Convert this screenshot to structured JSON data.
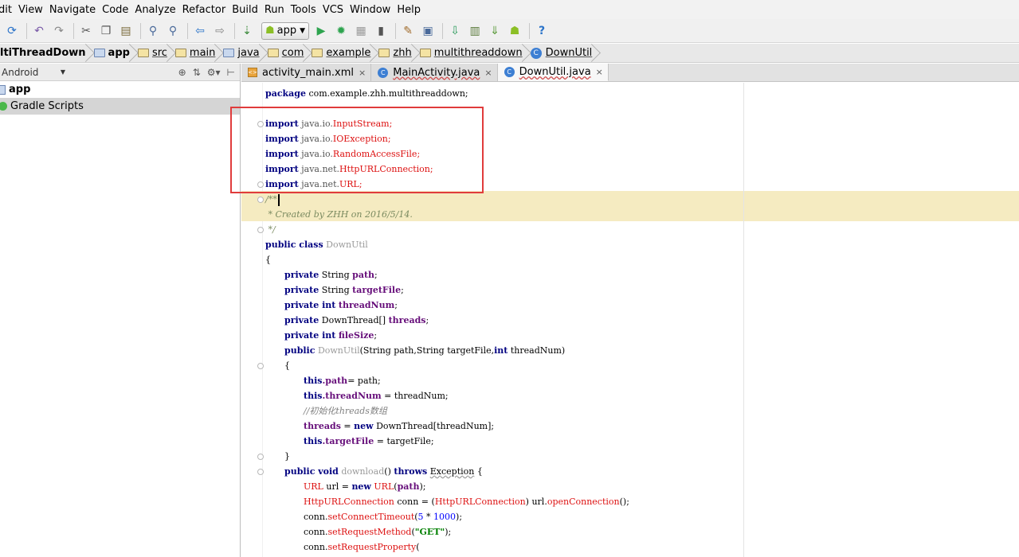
{
  "menu": [
    "dit",
    "View",
    "Navigate",
    "Code",
    "Analyze",
    "Refactor",
    "Build",
    "Run",
    "Tools",
    "VCS",
    "Window",
    "Help"
  ],
  "toolbar": {
    "run_config": "app"
  },
  "breadcrumb": [
    "ltiThreadDown",
    "app",
    "src",
    "main",
    "java",
    "com",
    "example",
    "zhh",
    "multithreaddown",
    "DownUtil"
  ],
  "project_panel": {
    "view_mode": "Android",
    "items": [
      {
        "label": "app"
      },
      {
        "label": "Gradle Scripts"
      }
    ]
  },
  "tabs": [
    {
      "label": "activity_main.xml",
      "close": "×"
    },
    {
      "label": "MainActivity.java",
      "close": "×"
    },
    {
      "label": "DownUtil.java",
      "close": "×"
    }
  ],
  "code": {
    "package_kw": "package",
    "package_name": "com.example.zhh.multithreaddown;",
    "imports": [
      {
        "kw": "import",
        "pkg": "java.io.",
        "cls": "InputStream",
        "end": ";"
      },
      {
        "kw": "import",
        "pkg": "java.io.",
        "cls": "IOException",
        "end": ";"
      },
      {
        "kw": "import",
        "pkg": "java.io.",
        "cls": "RandomAccessFile",
        "end": ";"
      },
      {
        "kw": "import",
        "pkg": "java.net.",
        "cls": "HttpURLConnection",
        "end": ";"
      },
      {
        "kw": "import",
        "pkg": "java.net.",
        "cls": "URL",
        "end": ";"
      }
    ],
    "doc_open": "/**",
    "doc_body": " * Created by ZHH on 2016/5/14.",
    "doc_close": " */",
    "class_decl": {
      "mods": "public class",
      "name": "DownUtil"
    },
    "open_brace": "{",
    "fields": [
      {
        "mods": "private",
        "type": "String",
        "name": "path",
        "end": ";"
      },
      {
        "mods": "private",
        "type": "String",
        "name": "targetFile",
        "end": ";"
      },
      {
        "mods": "private int",
        "type": "",
        "name": "threadNum",
        "end": ";"
      },
      {
        "mods": "private",
        "type": "DownThread[]",
        "name": "threads",
        "end": ";"
      },
      {
        "mods": "private int",
        "type": "",
        "name": "fileSize",
        "end": ";"
      }
    ],
    "ctor": {
      "mods": "public",
      "name": "DownUtil",
      "params": "(String path,String targetFile,",
      "int_kw": "int",
      "param_end": " threadNum)"
    },
    "ctor_open": "{",
    "ctor_body": [
      {
        "this": "this",
        "field": ".path",
        "rest": "= path;"
      },
      {
        "this": "this",
        "field": ".threadNum",
        "rest": " = threadNum;"
      }
    ],
    "ctor_comment": "//初始化threads数组",
    "ctor_threads": {
      "field": "threads",
      "eq": " = ",
      "new_kw": "new",
      "rest": " DownThread[threadNum];"
    },
    "ctor_target": {
      "this": "this",
      "field": ".targetFile",
      "rest": " = targetFile;"
    },
    "ctor_close": "}",
    "download": {
      "mods": "public void",
      "name": "download",
      "mid": "() ",
      "throws_kw": "throws",
      "exc": "Exception",
      "end": " {"
    },
    "download_body": {
      "l1": {
        "cls": "URL",
        "a": " url = ",
        "new_kw": "new",
        "b": " ",
        "cls2": "URL",
        "c": "(",
        "field": "path",
        "d": ");"
      },
      "l2": {
        "cls": "HttpURLConnection",
        "a": " conn = (",
        "cls2": "HttpURLConnection",
        "b": ") url.",
        "meth": "openConnection",
        "c": "();"
      },
      "l3": {
        "a": "conn.",
        "meth": "setConnectTimeout",
        "b": "(",
        "num": "5",
        "c": " * ",
        "num2": "1000",
        "d": ");"
      },
      "l4": {
        "a": "conn.",
        "meth": "setRequestMethod",
        "b": "(",
        "str": "\"GET\"",
        "c": ");"
      },
      "l5": {
        "a": "conn.",
        "meth": "setRequestProperty",
        "b": "("
      }
    }
  }
}
